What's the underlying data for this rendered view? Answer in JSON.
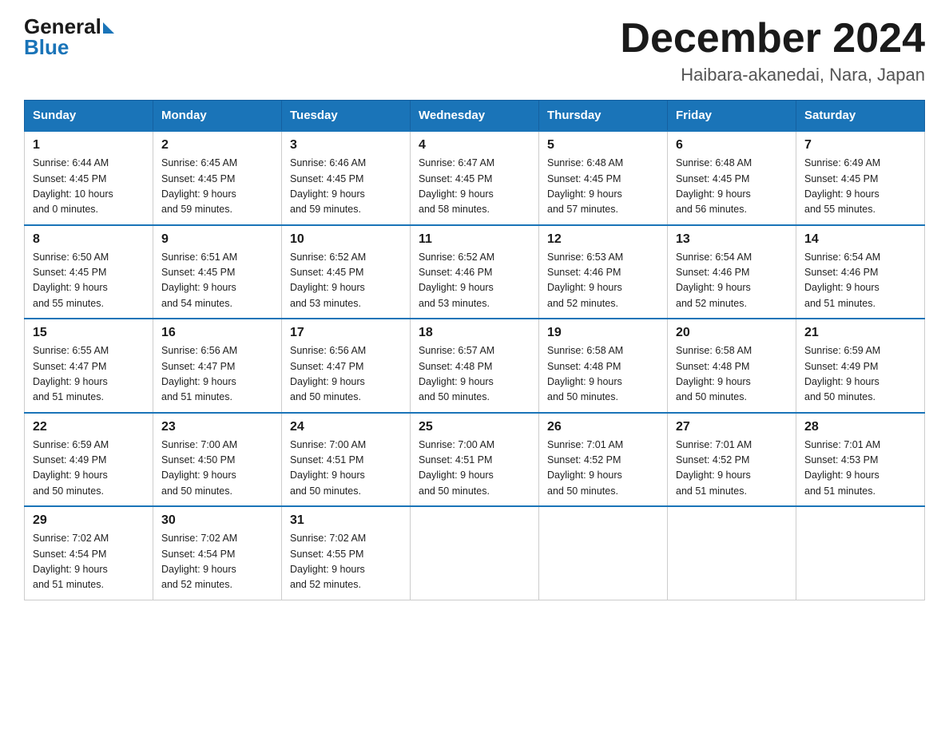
{
  "header": {
    "logo_general": "General",
    "logo_blue": "Blue",
    "month": "December 2024",
    "location": "Haibara-akanedai, Nara, Japan"
  },
  "days_of_week": [
    "Sunday",
    "Monday",
    "Tuesday",
    "Wednesday",
    "Thursday",
    "Friday",
    "Saturday"
  ],
  "weeks": [
    [
      {
        "day": "1",
        "sunrise": "6:44 AM",
        "sunset": "4:45 PM",
        "daylight": "10 hours and 0 minutes."
      },
      {
        "day": "2",
        "sunrise": "6:45 AM",
        "sunset": "4:45 PM",
        "daylight": "9 hours and 59 minutes."
      },
      {
        "day": "3",
        "sunrise": "6:46 AM",
        "sunset": "4:45 PM",
        "daylight": "9 hours and 59 minutes."
      },
      {
        "day": "4",
        "sunrise": "6:47 AM",
        "sunset": "4:45 PM",
        "daylight": "9 hours and 58 minutes."
      },
      {
        "day": "5",
        "sunrise": "6:48 AM",
        "sunset": "4:45 PM",
        "daylight": "9 hours and 57 minutes."
      },
      {
        "day": "6",
        "sunrise": "6:48 AM",
        "sunset": "4:45 PM",
        "daylight": "9 hours and 56 minutes."
      },
      {
        "day": "7",
        "sunrise": "6:49 AM",
        "sunset": "4:45 PM",
        "daylight": "9 hours and 55 minutes."
      }
    ],
    [
      {
        "day": "8",
        "sunrise": "6:50 AM",
        "sunset": "4:45 PM",
        "daylight": "9 hours and 55 minutes."
      },
      {
        "day": "9",
        "sunrise": "6:51 AM",
        "sunset": "4:45 PM",
        "daylight": "9 hours and 54 minutes."
      },
      {
        "day": "10",
        "sunrise": "6:52 AM",
        "sunset": "4:45 PM",
        "daylight": "9 hours and 53 minutes."
      },
      {
        "day": "11",
        "sunrise": "6:52 AM",
        "sunset": "4:46 PM",
        "daylight": "9 hours and 53 minutes."
      },
      {
        "day": "12",
        "sunrise": "6:53 AM",
        "sunset": "4:46 PM",
        "daylight": "9 hours and 52 minutes."
      },
      {
        "day": "13",
        "sunrise": "6:54 AM",
        "sunset": "4:46 PM",
        "daylight": "9 hours and 52 minutes."
      },
      {
        "day": "14",
        "sunrise": "6:54 AM",
        "sunset": "4:46 PM",
        "daylight": "9 hours and 51 minutes."
      }
    ],
    [
      {
        "day": "15",
        "sunrise": "6:55 AM",
        "sunset": "4:47 PM",
        "daylight": "9 hours and 51 minutes."
      },
      {
        "day": "16",
        "sunrise": "6:56 AM",
        "sunset": "4:47 PM",
        "daylight": "9 hours and 51 minutes."
      },
      {
        "day": "17",
        "sunrise": "6:56 AM",
        "sunset": "4:47 PM",
        "daylight": "9 hours and 50 minutes."
      },
      {
        "day": "18",
        "sunrise": "6:57 AM",
        "sunset": "4:48 PM",
        "daylight": "9 hours and 50 minutes."
      },
      {
        "day": "19",
        "sunrise": "6:58 AM",
        "sunset": "4:48 PM",
        "daylight": "9 hours and 50 minutes."
      },
      {
        "day": "20",
        "sunrise": "6:58 AM",
        "sunset": "4:48 PM",
        "daylight": "9 hours and 50 minutes."
      },
      {
        "day": "21",
        "sunrise": "6:59 AM",
        "sunset": "4:49 PM",
        "daylight": "9 hours and 50 minutes."
      }
    ],
    [
      {
        "day": "22",
        "sunrise": "6:59 AM",
        "sunset": "4:49 PM",
        "daylight": "9 hours and 50 minutes."
      },
      {
        "day": "23",
        "sunrise": "7:00 AM",
        "sunset": "4:50 PM",
        "daylight": "9 hours and 50 minutes."
      },
      {
        "day": "24",
        "sunrise": "7:00 AM",
        "sunset": "4:51 PM",
        "daylight": "9 hours and 50 minutes."
      },
      {
        "day": "25",
        "sunrise": "7:00 AM",
        "sunset": "4:51 PM",
        "daylight": "9 hours and 50 minutes."
      },
      {
        "day": "26",
        "sunrise": "7:01 AM",
        "sunset": "4:52 PM",
        "daylight": "9 hours and 50 minutes."
      },
      {
        "day": "27",
        "sunrise": "7:01 AM",
        "sunset": "4:52 PM",
        "daylight": "9 hours and 51 minutes."
      },
      {
        "day": "28",
        "sunrise": "7:01 AM",
        "sunset": "4:53 PM",
        "daylight": "9 hours and 51 minutes."
      }
    ],
    [
      {
        "day": "29",
        "sunrise": "7:02 AM",
        "sunset": "4:54 PM",
        "daylight": "9 hours and 51 minutes."
      },
      {
        "day": "30",
        "sunrise": "7:02 AM",
        "sunset": "4:54 PM",
        "daylight": "9 hours and 52 minutes."
      },
      {
        "day": "31",
        "sunrise": "7:02 AM",
        "sunset": "4:55 PM",
        "daylight": "9 hours and 52 minutes."
      },
      null,
      null,
      null,
      null
    ]
  ],
  "labels": {
    "sunrise": "Sunrise:",
    "sunset": "Sunset:",
    "daylight": "Daylight:"
  },
  "accent_color": "#1a74b8"
}
